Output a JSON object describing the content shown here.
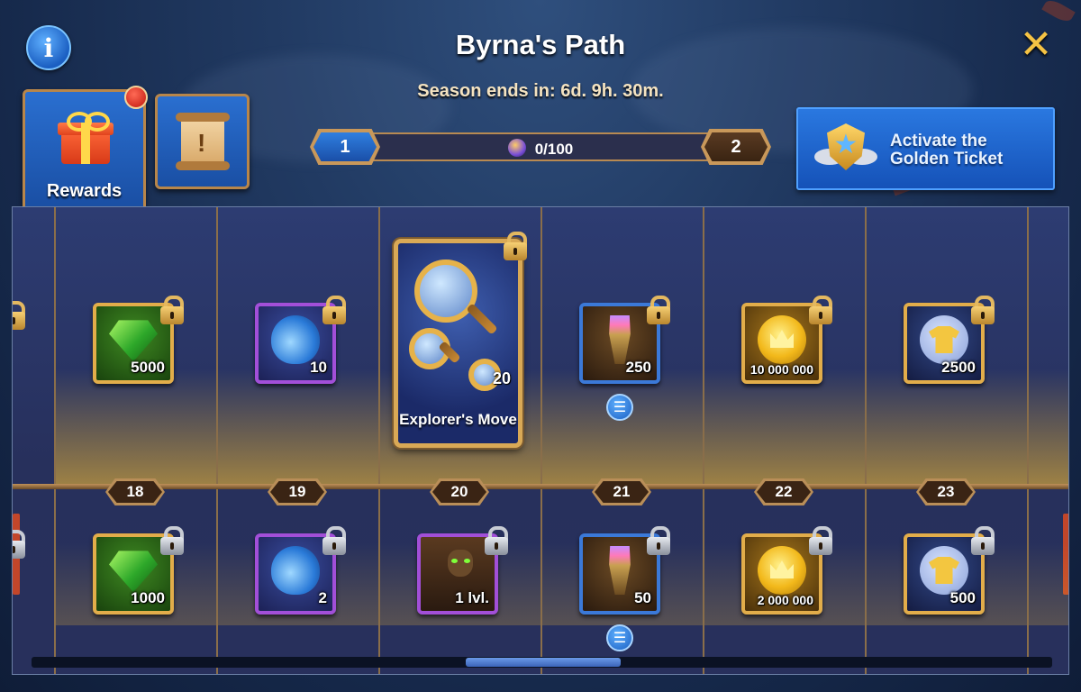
{
  "header": {
    "title": "Byrna's Path",
    "season_label": "Season ends in: 6d. 9h. 30m."
  },
  "tabs": {
    "rewards_label": "Rewards"
  },
  "progress": {
    "current_level": "1",
    "next_level": "2",
    "text": "0/100",
    "fraction": 0
  },
  "golden_ticket": {
    "label": "Activate the Golden Ticket"
  },
  "levels": [
    "18",
    "19",
    "20",
    "21",
    "22",
    "23"
  ],
  "top_rewards": [
    {
      "amount": "5000"
    },
    {
      "amount": "10"
    },
    {
      "amount": "20",
      "name": "Explorer's Move"
    },
    {
      "amount": "250"
    },
    {
      "amount": "10 000 000"
    },
    {
      "amount": "2500"
    }
  ],
  "bottom_rewards": [
    {
      "amount": "1000"
    },
    {
      "amount": "2"
    },
    {
      "amount": "1 lvl."
    },
    {
      "amount": "50"
    },
    {
      "amount": "2 000 000"
    },
    {
      "amount": "500"
    }
  ],
  "icons": {
    "info": "info-icon",
    "close": "close-icon",
    "gift": "gift-icon",
    "scroll": "scroll-icon",
    "lock_premium": "gold-lock-icon",
    "lock_free": "silver-lock-icon",
    "list": "list-icon"
  },
  "colors": {
    "accent": "#f5c344",
    "button_blue": "#1b5fc2",
    "frame_gold": "#d9a444",
    "frame_purple": "#a24fd8",
    "frame_blue": "#3b79d8"
  }
}
